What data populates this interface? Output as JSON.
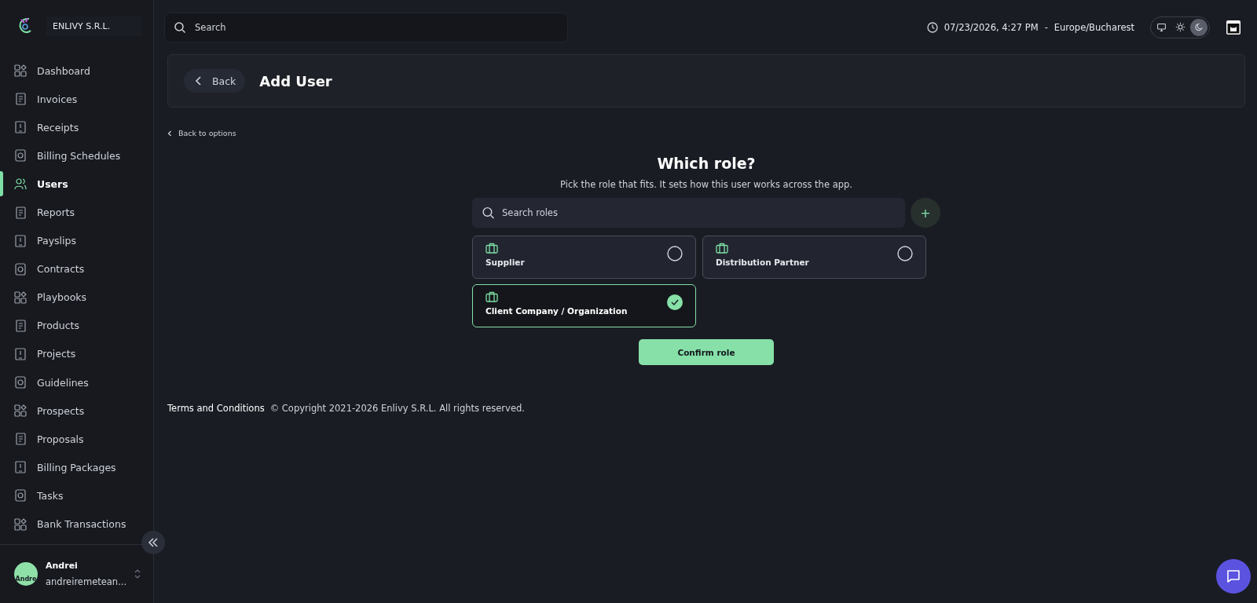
{
  "sidebar": {
    "company": "ENLIVY S.R.L.",
    "items": [
      {
        "label": "Dashboard",
        "selected": false
      },
      {
        "label": "Invoices",
        "selected": false
      },
      {
        "label": "Receipts",
        "selected": false
      },
      {
        "label": "Billing Schedules",
        "selected": false
      },
      {
        "label": "Users",
        "selected": true
      },
      {
        "label": "Reports",
        "selected": false
      },
      {
        "label": "Payslips",
        "selected": false
      },
      {
        "label": "Contracts",
        "selected": false
      },
      {
        "label": "Playbooks",
        "selected": false
      },
      {
        "label": "Products",
        "selected": false
      },
      {
        "label": "Projects",
        "selected": false
      },
      {
        "label": "Guidelines",
        "selected": false
      },
      {
        "label": "Prospects",
        "selected": false
      },
      {
        "label": "Proposals",
        "selected": false
      },
      {
        "label": "Billing Packages",
        "selected": false
      },
      {
        "label": "Tasks",
        "selected": false
      },
      {
        "label": "Bank Transactions",
        "selected": false
      }
    ],
    "user": {
      "avatar_text": "Andre",
      "name": "Andrei",
      "email": "andreiremetean..."
    }
  },
  "topbar": {
    "search": {
      "placeholder": "Search"
    },
    "datetime": "07/23/2026, 4:27 PM",
    "separator": "-",
    "timezone": "Europe/Bucharest",
    "theme_options": [
      {
        "kind": "system",
        "selected": false
      },
      {
        "kind": "light",
        "selected": false
      },
      {
        "kind": "dark",
        "selected": true
      }
    ]
  },
  "header": {
    "back_button": "Back",
    "title": "Add User"
  },
  "back_link": "Back to options",
  "role_picker": {
    "title": "Which role?",
    "subtitle": "Pick the role that fits. It sets how this user works across the app.",
    "search": {
      "placeholder": "Search roles"
    },
    "add_button": "+",
    "roles": [
      {
        "label": "Supplier",
        "selected": false
      },
      {
        "label": "Distribution Partner",
        "selected": false
      },
      {
        "label": "Client Company / Organization",
        "selected": true
      }
    ],
    "confirm_button": "Confirm role"
  },
  "footer": {
    "terms_link": "Terms and Conditions",
    "copyright": "© Copyright 2021-2026 Enlivy S.R.L. All rights reserved."
  }
}
